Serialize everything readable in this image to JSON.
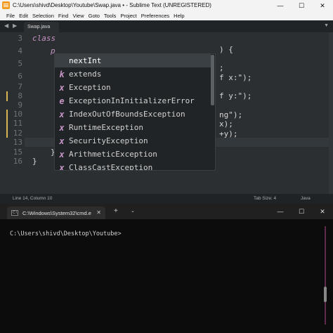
{
  "sublime": {
    "title": "C:\\Users\\shivd\\Desktop\\Youtube\\Swap.java • - Sublime Text (UNREGISTERED)",
    "menu": [
      "File",
      "Edit",
      "Selection",
      "Find",
      "View",
      "Goto",
      "Tools",
      "Project",
      "Preferences",
      "Help"
    ],
    "tab_label": "Swap.java",
    "line_numbers": [
      "3",
      "4",
      "5",
      "6",
      "7",
      "8",
      "9",
      "10",
      "11",
      "12",
      "13",
      "14",
      "15",
      "16"
    ],
    "active_line": "14",
    "code": {
      "l3": "class",
      "l4": "p",
      "l4r": ") {",
      "l6r": ";",
      "l7r": "f x:\");",
      "l9r": "f y:\");",
      "l11r": "ng\");",
      "l12r": "x);",
      "l13r": "+y);",
      "l14": "x",
      "l15": "}",
      "l16": "}"
    },
    "autocomplete": [
      {
        "kind": "",
        "label": "nextInt"
      },
      {
        "kind": "k",
        "label": "extends"
      },
      {
        "kind": "x",
        "label": "Exception"
      },
      {
        "kind": "e",
        "label": "ExceptionInInitializerError"
      },
      {
        "kind": "x",
        "label": "IndexOutOfBoundsException"
      },
      {
        "kind": "x",
        "label": "RuntimeException"
      },
      {
        "kind": "x",
        "label": "SecurityException"
      },
      {
        "kind": "x",
        "label": "ArithmeticException"
      },
      {
        "kind": "x",
        "label": "ClassCastException"
      }
    ],
    "status": {
      "position": "Line 14, Column 10",
      "tab_size": "Tab Size: 4",
      "syntax": "Java"
    }
  },
  "terminal": {
    "tab_label": "C:\\Windows\\System32\\cmd.e",
    "tab_icon_text": "C:\\",
    "prompt": "C:\\Users\\shivd\\Desktop\\Youtube>"
  },
  "colors": {
    "accent_orange": "#f49a1f",
    "keyword": "#c594c5",
    "editor_bg": "#2b2f32",
    "terminal_bg": "#0c0c0c"
  }
}
